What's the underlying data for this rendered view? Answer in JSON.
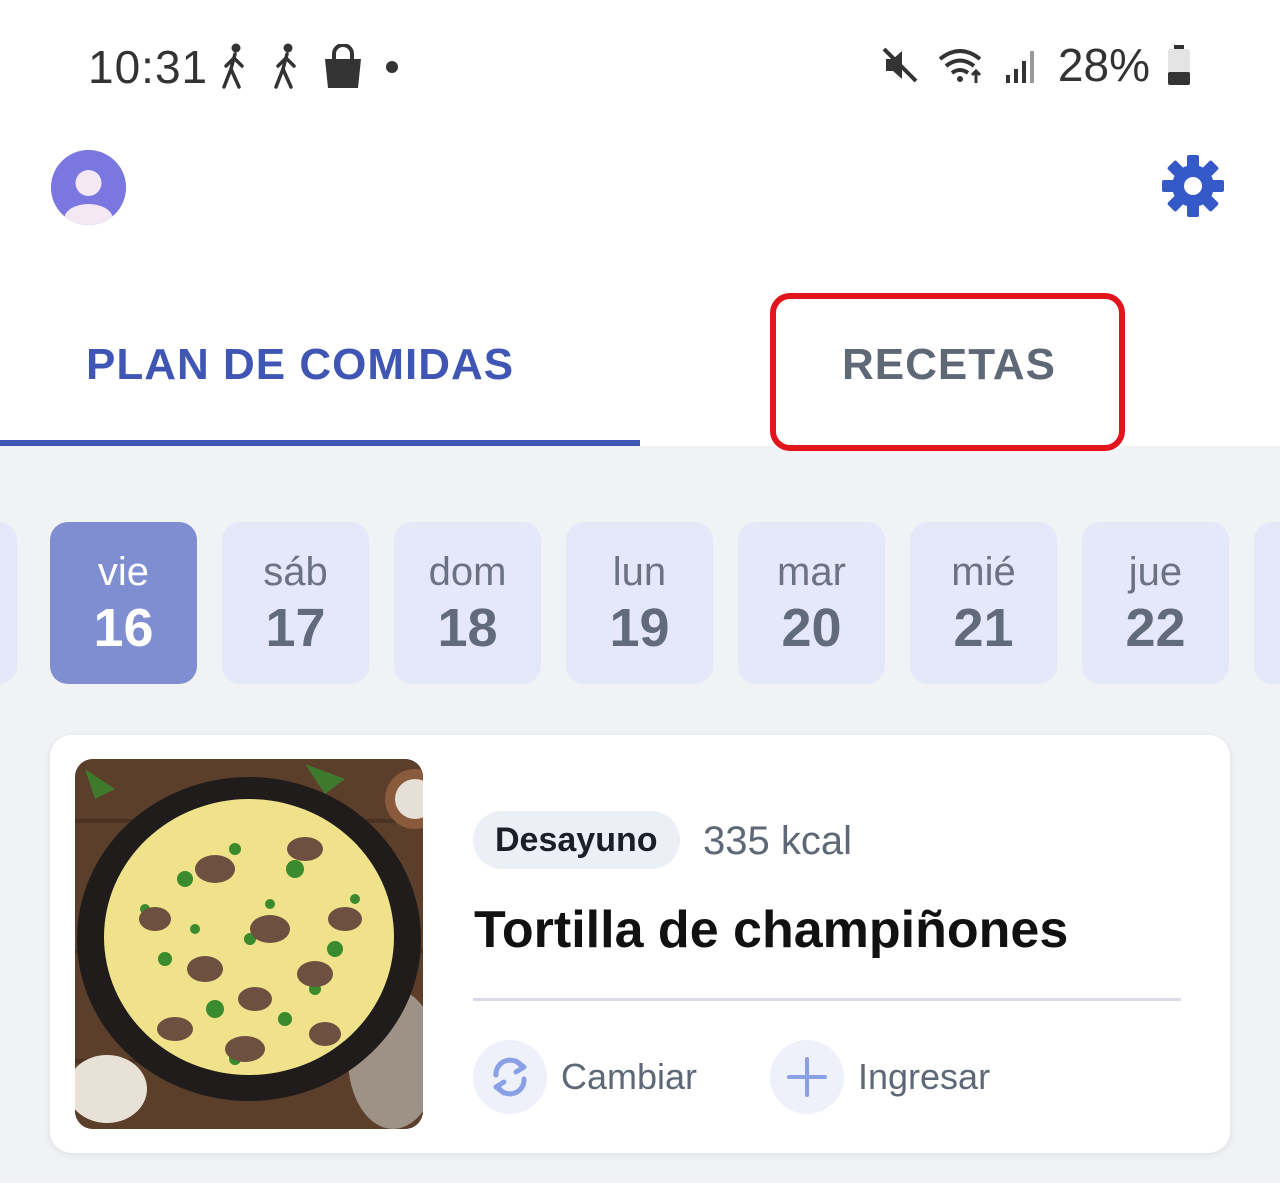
{
  "status_bar": {
    "time": "10:31",
    "battery": "28%",
    "icons_left": [
      "walking-person-icon",
      "walking-person-icon",
      "shopping-bag-icon",
      "dot-icon"
    ],
    "icons_right": [
      "mute-icon",
      "wifi-icon",
      "signal-icon",
      "battery-icon"
    ]
  },
  "header": {
    "avatar_icon": "user-avatar-icon",
    "settings_icon": "gear-icon"
  },
  "tabs": [
    {
      "label": "PLAN DE COMIDAS",
      "active": true
    },
    {
      "label": "RECETAS",
      "active": false,
      "highlighted": true
    }
  ],
  "days": [
    {
      "name": "vie",
      "num": "16",
      "active": true
    },
    {
      "name": "sáb",
      "num": "17",
      "active": false
    },
    {
      "name": "dom",
      "num": "18",
      "active": false
    },
    {
      "name": "lun",
      "num": "19",
      "active": false
    },
    {
      "name": "mar",
      "num": "20",
      "active": false
    },
    {
      "name": "mié",
      "num": "21",
      "active": false
    },
    {
      "name": "jue",
      "num": "22",
      "active": false
    }
  ],
  "meal_card": {
    "meal_type": "Desayuno",
    "kcal": "335 kcal",
    "title": "Tortilla de champiñones",
    "actions": [
      {
        "label": "Cambiar",
        "icon": "swap-icon"
      },
      {
        "label": "Ingresar",
        "icon": "plus-icon"
      }
    ]
  },
  "colors": {
    "accent": "#4056b4",
    "active_day": "#7e8ed0",
    "day_bg": "#e5e8f8",
    "highlight": "#e3151c",
    "page_bg": "#f0f2f5"
  }
}
